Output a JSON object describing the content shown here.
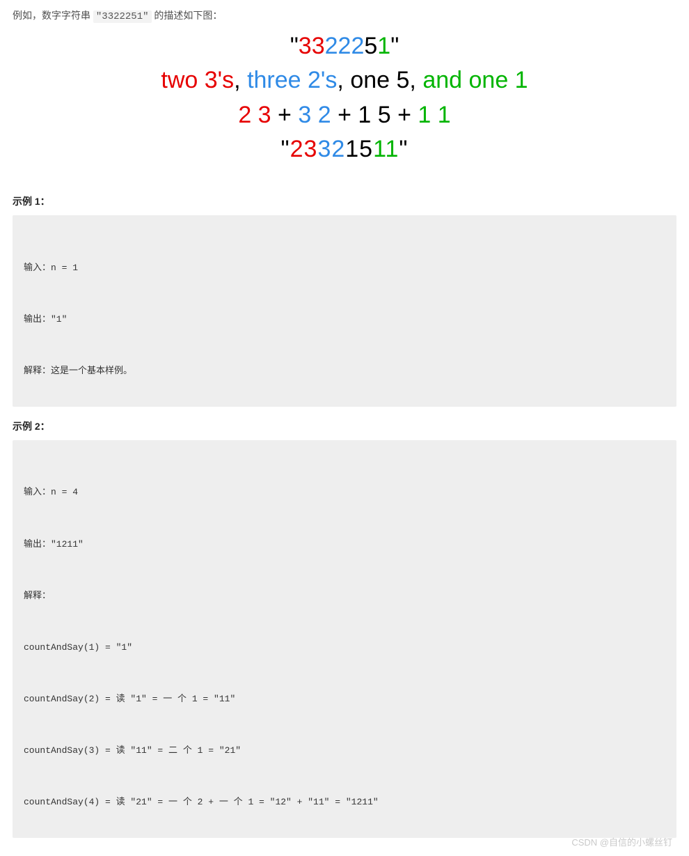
{
  "intro": {
    "prefix": "例如，数字字符串 ",
    "code": "\"3322251\"",
    "suffix": " 的描述如下图："
  },
  "figure": {
    "row1": {
      "open_quote": "\"",
      "s33": "33",
      "s222": "222",
      "s5": "5",
      "s1": "1",
      "close_quote": "\""
    },
    "row2": {
      "two": "two ",
      "threes": "3's",
      "sep1": ", ",
      "three": "three ",
      "twos": "2's",
      "sep2": ", ",
      "one5": "one 5",
      "sep3": ", ",
      "andone1": "and one 1"
    },
    "row3": {
      "t1a": "2 ",
      "t1b": "3",
      "plus1": " + ",
      "t2a": "3 ",
      "t2b": "2",
      "plus2": " + ",
      "t3": "1 5",
      "plus3": " + ",
      "t4a": "1 ",
      "t4b": "1"
    },
    "row4": {
      "open_quote": "\"",
      "p23": "23",
      "p32": "32",
      "p15": "15",
      "p11": "11",
      "close_quote": "\""
    }
  },
  "examples": {
    "ex1": {
      "title": "示例 1：",
      "lines": [
        "输入：n = 1",
        "输出：\"1\"",
        "解释：这是一个基本样例。"
      ]
    },
    "ex2": {
      "title": "示例 2：",
      "lines": [
        "输入：n = 4",
        "输出：\"1211\"",
        "解释：",
        "countAndSay(1) = \"1\"",
        "countAndSay(2) = 读 \"1\" = 一 个 1 = \"11\"",
        "countAndSay(3) = 读 \"11\" = 二 个 1 = \"21\"",
        "countAndSay(4) = 读 \"21\" = 一 个 2 + 一 个 1 = \"12\" + \"11\" = \"1211\""
      ]
    }
  },
  "watermark": "CSDN @自信的小螺丝钉"
}
